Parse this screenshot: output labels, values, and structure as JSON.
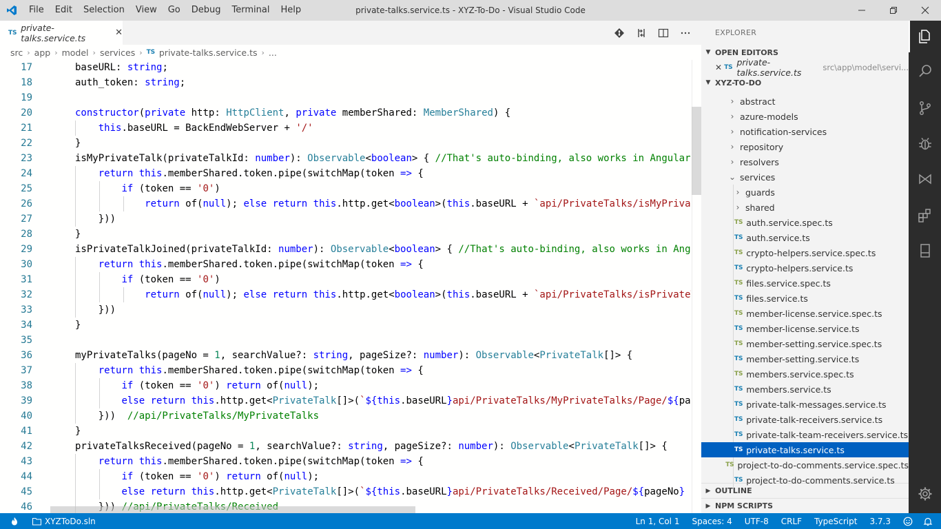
{
  "window": {
    "title": "private-talks.service.ts - XYZ-To-Do - Visual Studio Code",
    "menu": [
      "File",
      "Edit",
      "Selection",
      "View",
      "Go",
      "Debug",
      "Terminal",
      "Help"
    ]
  },
  "tab": {
    "badge": "TS",
    "label": "private-talks.service.ts",
    "close": "✕"
  },
  "breadcrumb": {
    "parts": [
      "src",
      "app",
      "model",
      "services"
    ],
    "file_badge": "TS",
    "file": "private-talks.service.ts",
    "ellipsis": "..."
  },
  "editor": {
    "line_numbers": [
      "17",
      "18",
      "19",
      "20",
      "21",
      "22",
      "23",
      "24",
      "25",
      "26",
      "27",
      "28",
      "29",
      "30",
      "31",
      "32",
      "33",
      "34",
      "35",
      "36",
      "37",
      "38",
      "39",
      "40",
      "41",
      "42",
      "43",
      "44",
      "45",
      "46"
    ]
  },
  "sidebar": {
    "title": "EXPLORER",
    "open_editors_label": "OPEN EDITORS",
    "open_editor": {
      "close": "✕",
      "badge": "TS",
      "name": "private-talks.service.ts",
      "path": "src\\app\\model\\servi..."
    },
    "project_label": "XYZ-TO-DO",
    "folders": [
      "abstract",
      "azure-models",
      "notification-services",
      "repository",
      "resolvers",
      "services"
    ],
    "subfolders": [
      "guards",
      "shared"
    ],
    "files": [
      {
        "name": "auth.service.spec.ts",
        "badge": "TS"
      },
      {
        "name": "auth.service.ts",
        "badge": "TS"
      },
      {
        "name": "crypto-helpers.service.spec.ts",
        "badge": "TS"
      },
      {
        "name": "crypto-helpers.service.ts",
        "badge": "TS"
      },
      {
        "name": "files.service.spec.ts",
        "badge": "TS"
      },
      {
        "name": "files.service.ts",
        "badge": "TS"
      },
      {
        "name": "member-license.service.spec.ts",
        "badge": "TS"
      },
      {
        "name": "member-license.service.ts",
        "badge": "TS"
      },
      {
        "name": "member-setting.service.spec.ts",
        "badge": "TS"
      },
      {
        "name": "member-setting.service.ts",
        "badge": "TS"
      },
      {
        "name": "members.service.spec.ts",
        "badge": "TS"
      },
      {
        "name": "members.service.ts",
        "badge": "TS"
      },
      {
        "name": "private-talk-messages.service.ts",
        "badge": "TS"
      },
      {
        "name": "private-talk-receivers.service.ts",
        "badge": "TS"
      },
      {
        "name": "private-talk-team-receivers.service.ts",
        "badge": "TS"
      },
      {
        "name": "private-talks.service.ts",
        "badge": "TS"
      },
      {
        "name": "project-to-do-comments.service.spec.ts",
        "badge": "TS"
      },
      {
        "name": "project-to-do-comments.service.ts",
        "badge": "TS"
      }
    ],
    "outline_label": "OUTLINE",
    "npm_label": "NPM SCRIPTS"
  },
  "statusbar": {
    "solution": "XYZToDo.sln",
    "position": "Ln 1, Col 1",
    "spaces": "Spaces: 4",
    "encoding": "UTF-8",
    "eol": "CRLF",
    "language": "TypeScript",
    "version": "3.7.3"
  },
  "colors": {
    "accent": "#007acc",
    "selection": "#0060c0",
    "activity_bar": "#2c2c2c",
    "title_bar": "#dddddd"
  }
}
